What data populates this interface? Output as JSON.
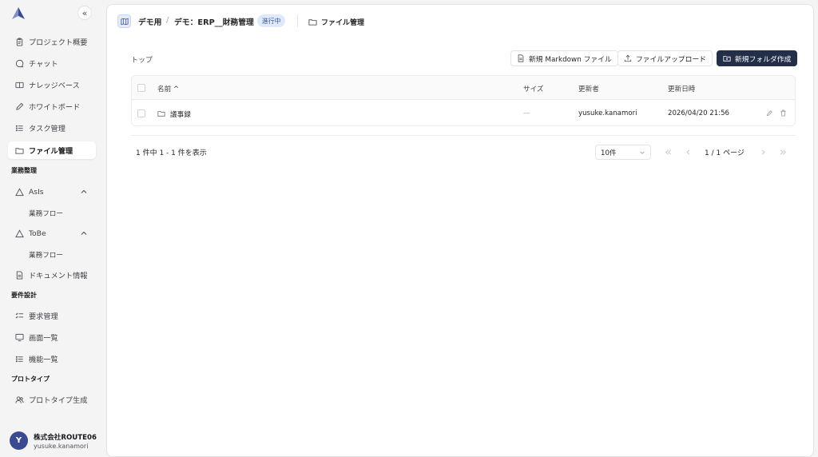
{
  "sidebar": {
    "collapse_glyph": "«",
    "items": [
      {
        "label": "プロジェクト概要",
        "icon": "clipboard-icon"
      },
      {
        "label": "チャット",
        "icon": "chat-icon"
      },
      {
        "label": "ナレッジベース",
        "icon": "book-icon"
      },
      {
        "label": "ホワイトボード",
        "icon": "pen-icon"
      },
      {
        "label": "タスク管理",
        "icon": "list-icon"
      },
      {
        "label": "ファイル管理",
        "icon": "folder-icon",
        "active": true
      }
    ],
    "sections": [
      {
        "label": "業務整理"
      },
      {
        "label": "要件設計"
      },
      {
        "label": "プロトタイプ"
      }
    ],
    "asis": {
      "label": "AsIs",
      "sub": "業務フロー"
    },
    "tobe": {
      "label": "ToBe",
      "sub": "業務フロー"
    },
    "document_info": "ドキュメント情報",
    "requirements": "要求管理",
    "screens": "画面一覧",
    "functions": "機能一覧",
    "prototype_gen": "プロトタイプ生成",
    "user": {
      "initial": "Y",
      "org": "株式会社ROUTE06",
      "name": "yusuke.kanamori"
    }
  },
  "header": {
    "breadcrumb": [
      "デモ用",
      "デモ：ERP__財務管理"
    ],
    "separator": "/",
    "status": "進行中",
    "page_title": "ファイル管理"
  },
  "toolbar": {
    "path": "トップ",
    "new_markdown": "新規 Markdown ファイル",
    "upload": "ファイルアップロード",
    "new_folder": "新規フォルダ作成"
  },
  "table": {
    "columns": {
      "name": "名前 ^",
      "size": "サイズ",
      "updated_by": "更新者",
      "updated_at": "更新日時"
    },
    "rows": [
      {
        "name": "議事録",
        "size": "—",
        "updated_by": "yusuke.kanamori",
        "updated_at": "2026/04/20 21:56"
      }
    ]
  },
  "pagination": {
    "summary": "1 件中 1 - 1 件を表示",
    "page_size": "10件",
    "page_info": "1 / 1 ページ"
  },
  "colors": {
    "accent": "#232e48",
    "badge_bg": "#e0e9fb",
    "badge_text": "#3b5ba9",
    "avatar": "#3b4a8f"
  }
}
